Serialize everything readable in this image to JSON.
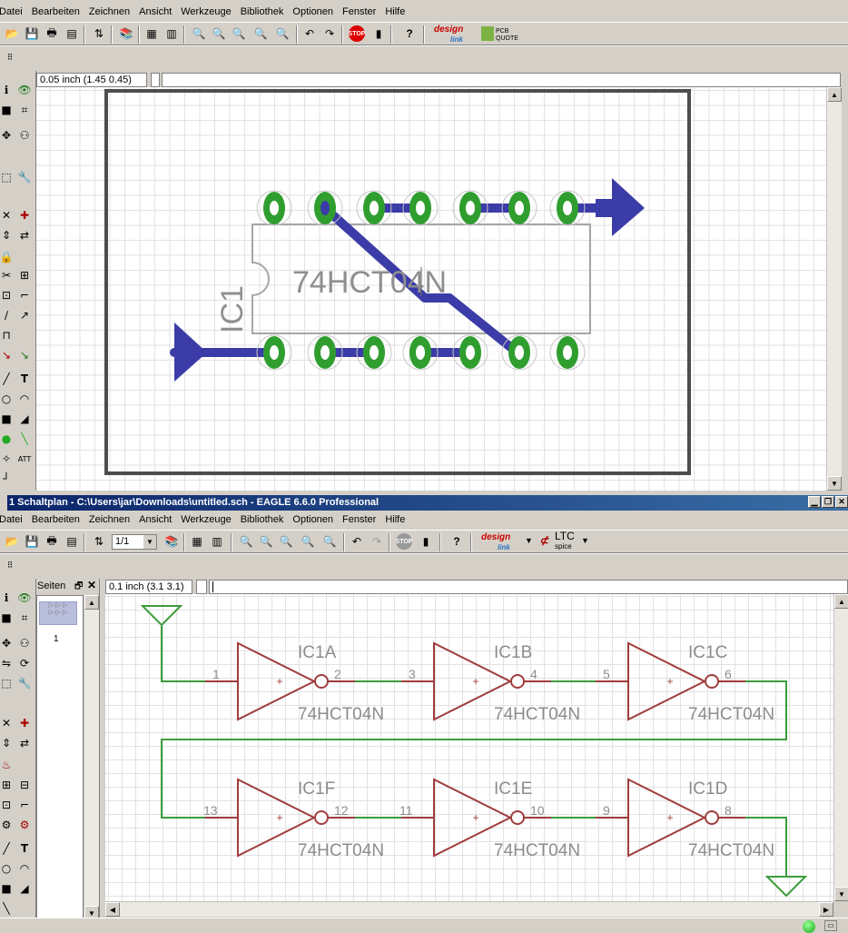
{
  "board": {
    "menu": [
      "Datei",
      "Bearbeiten",
      "Zeichnen",
      "Ansicht",
      "Werkzeuge",
      "Bibliothek",
      "Optionen",
      "Fenster",
      "Hilfe"
    ],
    "coord": "0.05 inch (1.45 0.45)",
    "part_name": "IC1",
    "part_value": "74HCT04N",
    "toolbar_logo1": "design",
    "toolbar_logo1_sub": "link",
    "toolbar_logo2": "PCB QUOTE"
  },
  "schematic": {
    "title": "1 Schaltplan - C:\\Users\\jar\\Downloads\\untitled.sch - EAGLE 6.6.0 Professional",
    "menu": [
      "Datei",
      "Bearbeiten",
      "Zeichnen",
      "Ansicht",
      "Werkzeuge",
      "Bibliothek",
      "Optionen",
      "Fenster",
      "Hilfe"
    ],
    "coord": "0.1 inch (3.1 3.1)",
    "sheet_select": "1/1",
    "pages_label": "Seiten",
    "page_number": "1",
    "ltc_label": "LTC",
    "ltc_sub": "spice",
    "gates": [
      {
        "name": "IC1A",
        "value": "74HCT04N",
        "in": "1",
        "out": "2"
      },
      {
        "name": "IC1B",
        "value": "74HCT04N",
        "in": "3",
        "out": "4"
      },
      {
        "name": "IC1C",
        "value": "74HCT04N",
        "in": "5",
        "out": "6"
      },
      {
        "name": "IC1F",
        "value": "74HCT04N",
        "in": "13",
        "out": "12"
      },
      {
        "name": "IC1E",
        "value": "74HCT04N",
        "in": "11",
        "out": "10"
      },
      {
        "name": "IC1D",
        "value": "74HCT04N",
        "in": "9",
        "out": "8"
      }
    ]
  },
  "colors": {
    "pcb_trace": "#3c3ca8",
    "pcb_pad": "#2f9e2f",
    "schematic_gate": "#a03c3c",
    "schematic_wire": "#3c9c3c",
    "window_title": "#0a246a"
  }
}
